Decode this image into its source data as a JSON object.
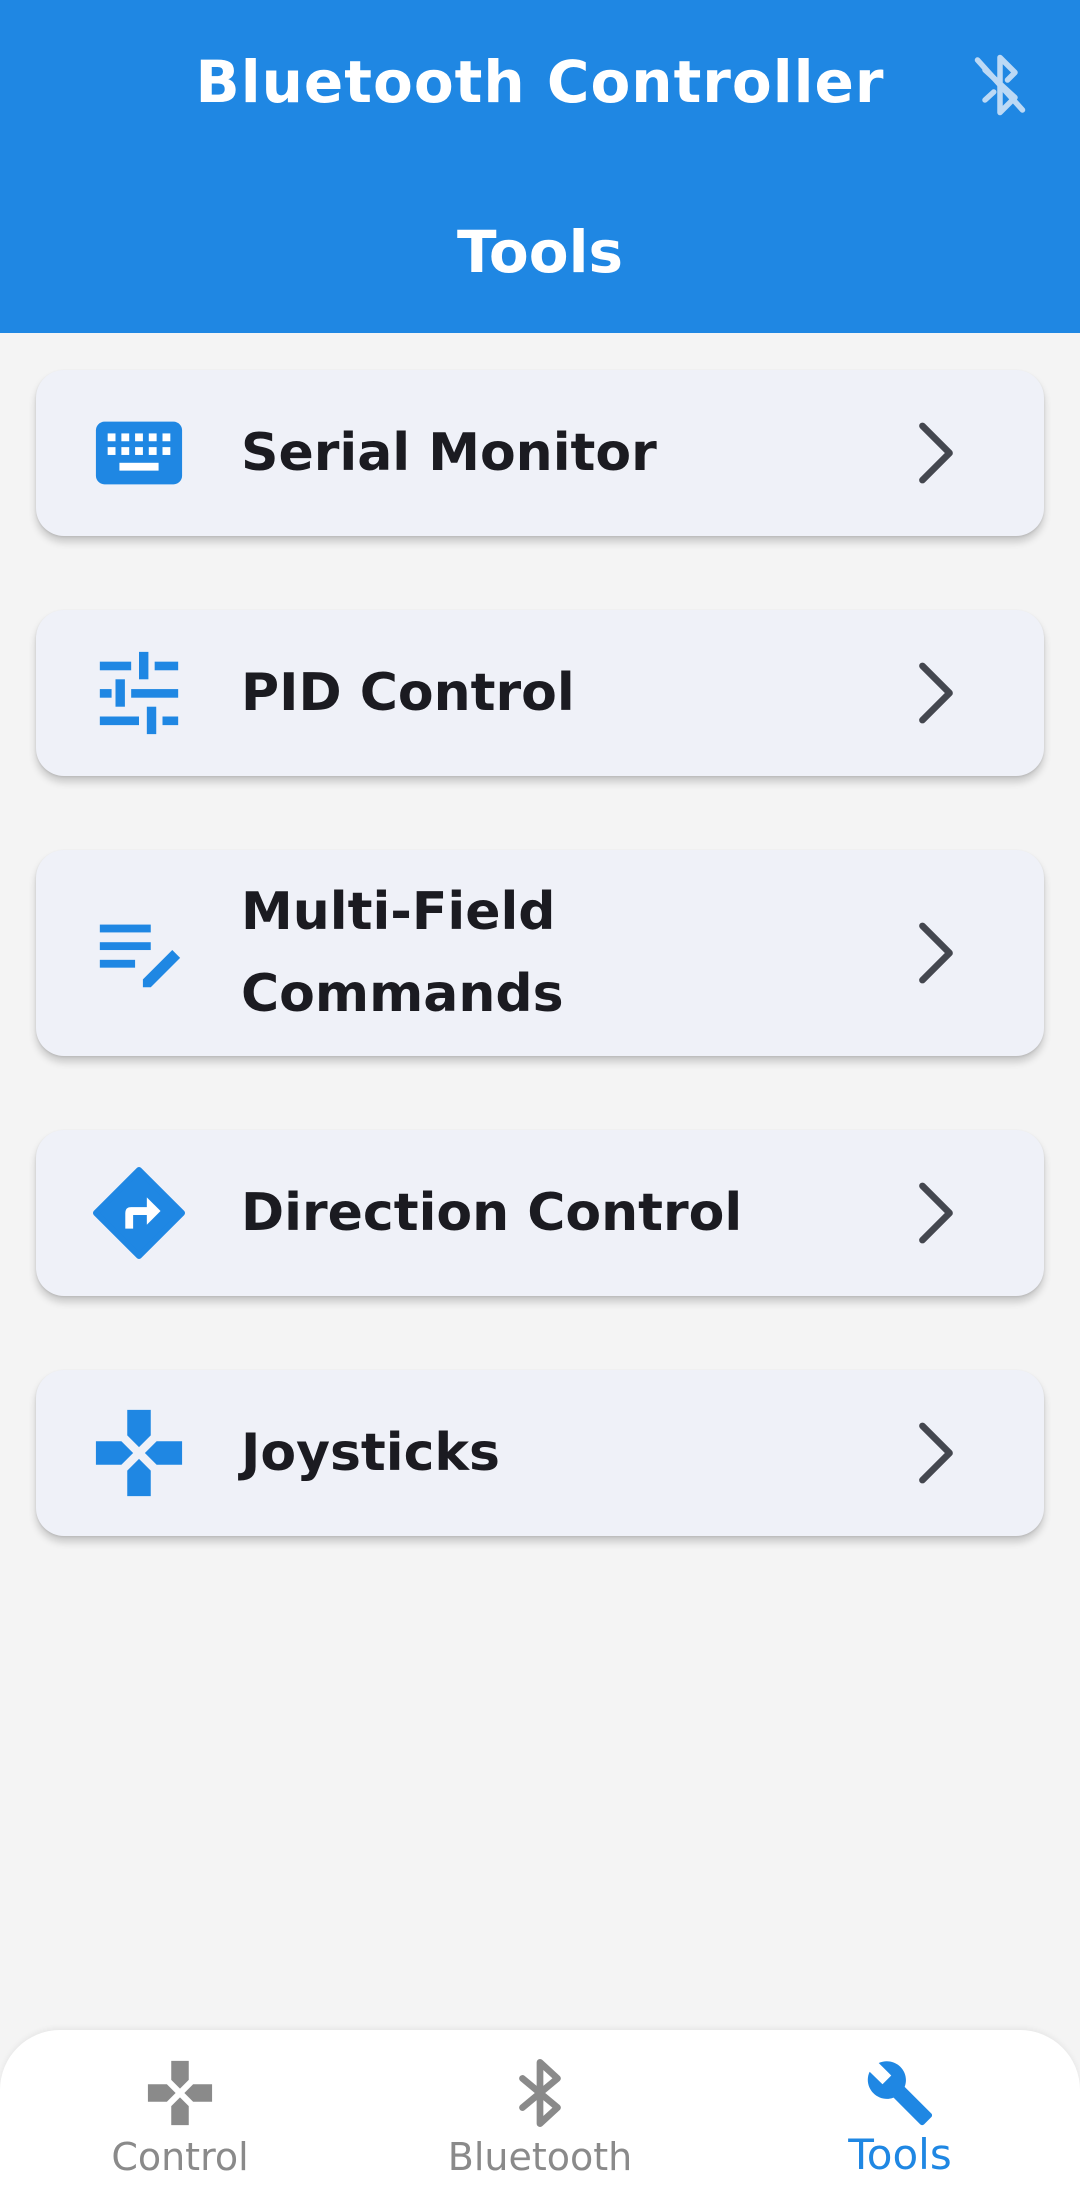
{
  "app": {
    "title": "Bluetooth Controller",
    "page_title": "Tools",
    "accent": "#1f87e3",
    "status_icon": "bluetooth-disabled-icon"
  },
  "tools": [
    {
      "label": "Serial Monitor",
      "icon": "keyboard-icon"
    },
    {
      "label": "PID Control",
      "icon": "tune-icon"
    },
    {
      "label": "Multi-Field Commands",
      "icon": "edit-note-icon"
    },
    {
      "label": "Direction Control",
      "icon": "directions-icon"
    },
    {
      "label": "Joysticks",
      "icon": "gamepad-icon"
    }
  ],
  "nav": [
    {
      "label": "Control",
      "icon": "gamepad-icon",
      "active": false
    },
    {
      "label": "Bluetooth",
      "icon": "bluetooth-icon",
      "active": false
    },
    {
      "label": "Tools",
      "icon": "wrench-icon",
      "active": true
    }
  ]
}
